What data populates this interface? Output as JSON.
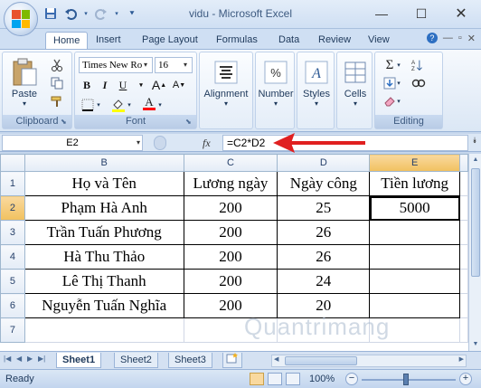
{
  "window": {
    "title": "vidu - Microsoft Excel",
    "controls": [
      "minimize-icon",
      "maximize-icon",
      "close-icon"
    ]
  },
  "quick_access": [
    "save-icon",
    "undo-icon",
    "redo-icon",
    "customize-icon"
  ],
  "ribbon": {
    "tabs": [
      "Home",
      "Insert",
      "Page Layout",
      "Formulas",
      "Data",
      "Review",
      "View"
    ],
    "active_tab": "Home",
    "groups": {
      "clipboard": {
        "label": "Clipboard",
        "paste_label": "Paste"
      },
      "font": {
        "label": "Font",
        "font_name": "Times New Ro",
        "font_size": "16"
      },
      "alignment": {
        "label": "Alignment"
      },
      "number": {
        "label": "Number"
      },
      "styles": {
        "label": "Styles"
      },
      "cells": {
        "label": "Cells"
      },
      "editing": {
        "label": "Editing"
      }
    },
    "accent_colors": {
      "highlight": "#ffff00",
      "font_color": "#ff0000"
    }
  },
  "formula_bar": {
    "name_box": "E2",
    "fx_label": "fx",
    "formula": "=C2*D2"
  },
  "sheet": {
    "column_headers": [
      "B",
      "C",
      "D",
      "E"
    ],
    "selected_column": "E",
    "row_numbers": [
      "1",
      "2",
      "3",
      "4",
      "5",
      "6",
      "7"
    ],
    "selected_row": "2",
    "header_row": [
      "Họ và Tên",
      "Lương ngày",
      "Ngày công",
      "Tiền lương"
    ],
    "rows": [
      [
        "Phạm Hà Anh",
        "200",
        "25",
        "5000"
      ],
      [
        "Trần Tuấn Phương",
        "200",
        "26",
        ""
      ],
      [
        "Hà Thu Thảo",
        "200",
        "26",
        ""
      ],
      [
        "Lê Thị Thanh",
        "200",
        "24",
        ""
      ],
      [
        "Nguyễn Tuấn Nghĩa",
        "200",
        "20",
        ""
      ]
    ]
  },
  "sheet_tabs": [
    "Sheet1",
    "Sheet2",
    "Sheet3"
  ],
  "active_sheet": "Sheet1",
  "status": {
    "text": "Ready",
    "zoom": "100%"
  },
  "annotation": {
    "arrow_color": "#e02020"
  },
  "watermark": "Quantrimang"
}
